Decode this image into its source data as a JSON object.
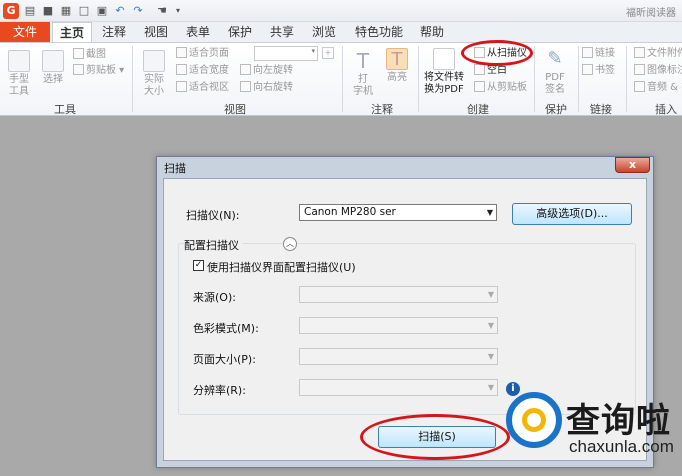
{
  "window": {
    "title": "福昕阅读器"
  },
  "quick_access": [
    "folder-icon",
    "save-icon",
    "print-icon",
    "new-icon",
    "undo-icon",
    "redo-icon",
    "hand-icon",
    "dropdown-icon"
  ],
  "tabs": [
    "文件",
    "主页",
    "注释",
    "视图",
    "表单",
    "保护",
    "共享",
    "浏览",
    "特色功能",
    "帮助"
  ],
  "ribbon": {
    "tools": {
      "hand": "手型\n工具",
      "select": "选择",
      "screenshot": "截图",
      "clipboard": "剪贴板",
      "label": "工具"
    },
    "view": {
      "actual": "实际\n大小",
      "fit_page": "适合页面",
      "fit_width": "适合宽度",
      "fit_visible": "适合视区",
      "rotate_left": "向左旋转",
      "rotate_right": "向右旋转",
      "label": "视图"
    },
    "comment": {
      "typewriter": "打\n字机",
      "highlight": "高亮",
      "label": "注释"
    },
    "create": {
      "convert": "将文件转\n换为PDF",
      "from_scanner": "从扫描仪",
      "blank": "空白",
      "from_clipboard": "从剪贴板",
      "label": "创建"
    },
    "protect": {
      "pdf_sign": "PDF\n签名",
      "label": "保护"
    },
    "links": {
      "link": "链接",
      "bookmark": "书签",
      "label": "链接"
    },
    "insert": {
      "file_attach": "文件附件",
      "image_annot": "图像标注",
      "audio_video": "音频 & 视频",
      "label": "插入"
    }
  },
  "dialog": {
    "title": "扫描",
    "close": "x",
    "scanner_label": "扫描仪(N):",
    "scanner_value": "Canon MP280 ser",
    "advanced_button": "高级选项(D)...",
    "config_group": "配置扫描仪",
    "use_scanner_ui": "使用扫描仪界面配置扫描仪(U)",
    "source_label": "来源(O):",
    "color_label": "色彩模式(M):",
    "page_size_label": "页面大小(P):",
    "resolution_label": "分辨率(R):",
    "scan_button": "扫描(S)"
  },
  "watermark": {
    "main": "查询啦",
    "sub": "chaxunla.com"
  }
}
